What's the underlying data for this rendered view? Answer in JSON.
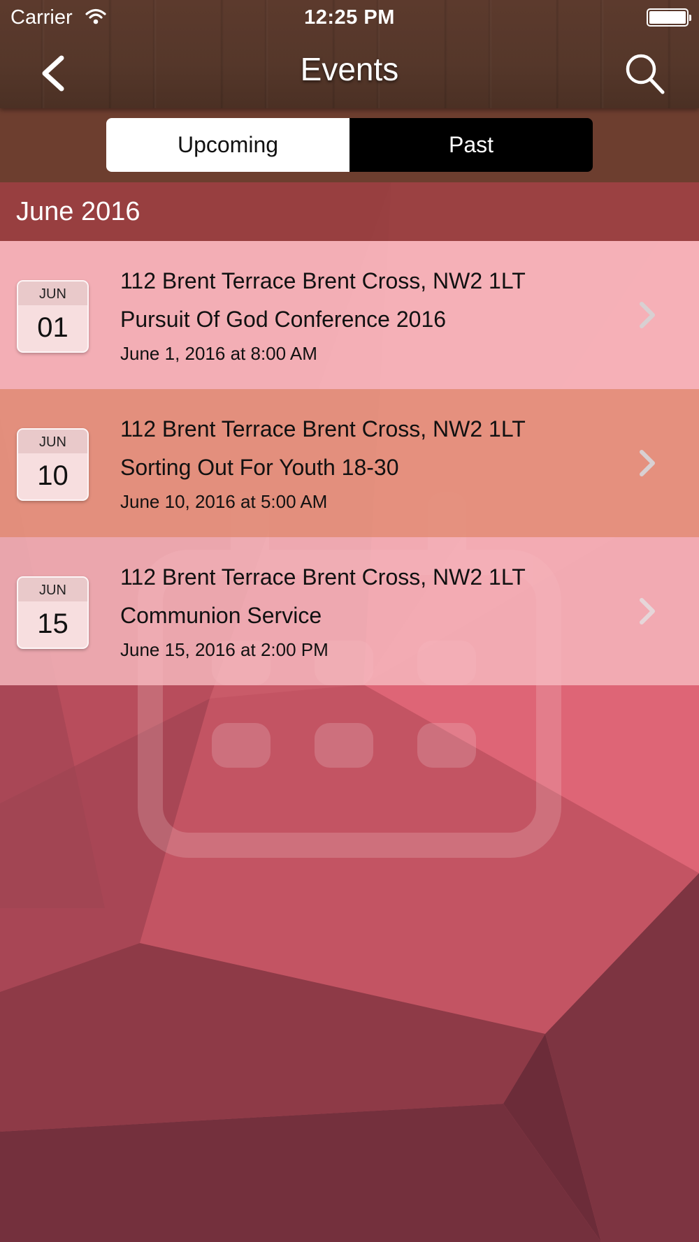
{
  "status_bar": {
    "carrier": "Carrier",
    "time": "12:25 PM"
  },
  "nav": {
    "title": "Events",
    "back_icon": "chevron-left-icon",
    "search_icon": "search-icon"
  },
  "segment": {
    "upcoming_label": "Upcoming",
    "past_label": "Past",
    "selected": "Upcoming"
  },
  "month_header": "June 2016",
  "events": [
    {
      "badge_month": "JUN",
      "badge_day": "01",
      "location": "112 Brent Terrace  Brent Cross, NW2 1LT",
      "name": "Pursuit Of God Conference 2016",
      "datetime": "June 1, 2016 at 8:00 AM"
    },
    {
      "badge_month": "JUN",
      "badge_day": "10",
      "location": "112 Brent Terrace  Brent Cross, NW2 1LT",
      "name": "Sorting Out For Youth 18-30",
      "datetime": "June 10, 2016 at 5:00 AM"
    },
    {
      "badge_month": "JUN",
      "badge_day": "15",
      "location": "112 Brent Terrace  Brent Cross, NW2 1LT",
      "name": "Communion Service",
      "datetime": "June 15, 2016 at 2:00 PM"
    }
  ],
  "colors": {
    "header_wood": "#5c3a2d",
    "segment_bar": "#6d3e2f",
    "month_header": "#963e3e",
    "row_pink": "#f7b5bb",
    "row_orange": "#e5927e",
    "background_red": "#c85a66"
  }
}
